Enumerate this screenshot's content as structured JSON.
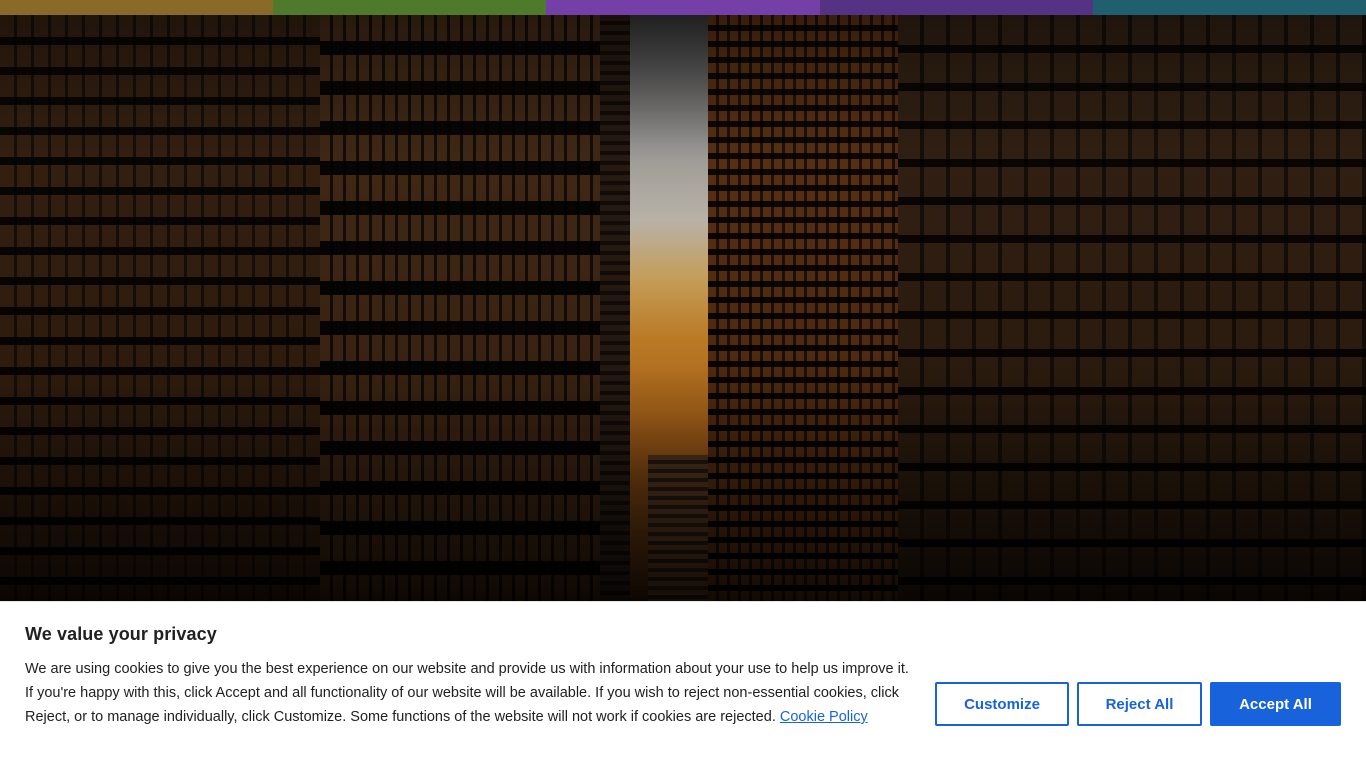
{
  "color_strip": {
    "colors": [
      "#8a6a27",
      "#4d7a2b",
      "#7440a8",
      "#553284",
      "#225f6e"
    ]
  },
  "hero": {
    "image": "city-canyon-sunset"
  },
  "cookie_banner": {
    "title": "We value your privacy",
    "message": "We are using cookies to give you the best experience on our website and provide us with information about your use to help us improve it. If you're happy with this, click Accept and all functionality of our website will be available. If you wish to reject non-essential cookies, click Reject, or to manage individually, click Customize. Some functions of the website will not work if cookies are rejected.",
    "policy_link": "Cookie Policy",
    "buttons": {
      "customize": "Customize",
      "reject": "Reject All",
      "accept": "Accept All"
    },
    "accent_color": "#1863dc"
  }
}
